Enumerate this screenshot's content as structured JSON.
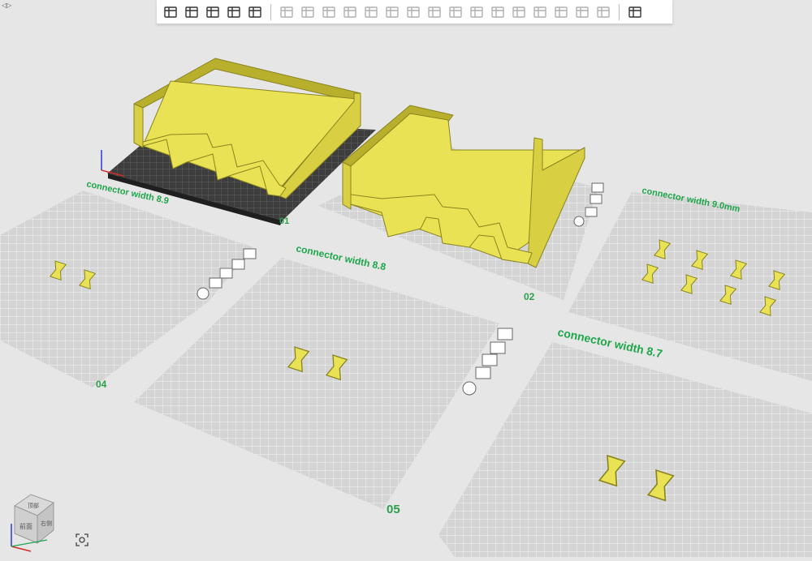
{
  "toolbar": {
    "buttons": [
      {
        "icon": "add-cube-icon",
        "enabled": true
      },
      {
        "icon": "add-plate-icon",
        "enabled": true
      },
      {
        "icon": "auto-orient-icon",
        "enabled": true
      },
      {
        "icon": "arrange-icon",
        "enabled": true
      },
      {
        "icon": "split-layers-icon",
        "enabled": true
      },
      {
        "sep": true
      },
      {
        "icon": "move-icon",
        "enabled": false
      },
      {
        "icon": "rotate-icon",
        "enabled": false
      },
      {
        "icon": "scale-icon",
        "enabled": false
      },
      {
        "icon": "lay-on-face-icon",
        "enabled": false
      },
      {
        "icon": "cut-icon",
        "enabled": false
      },
      {
        "icon": "boolean-icon",
        "enabled": false
      },
      {
        "icon": "support-paint-icon",
        "enabled": false
      },
      {
        "icon": "color-paint-icon",
        "enabled": false
      },
      {
        "icon": "text-icon",
        "enabled": false
      },
      {
        "icon": "measure-icon",
        "enabled": false
      },
      {
        "icon": "assembly-icon",
        "enabled": false
      },
      {
        "icon": "variable-layer-icon",
        "enabled": false
      },
      {
        "icon": "layers-stack-icon",
        "enabled": false
      },
      {
        "icon": "object-list-icon",
        "enabled": false
      },
      {
        "icon": "plate-list-icon",
        "enabled": false
      },
      {
        "icon": "ruler-icon",
        "enabled": false
      },
      {
        "sep": true
      },
      {
        "icon": "view-settings-icon",
        "enabled": true
      }
    ]
  },
  "plates": [
    {
      "id": "plate-01",
      "number": "01",
      "label": ""
    },
    {
      "id": "plate-02",
      "number": "02",
      "label": ""
    },
    {
      "id": "plate-04",
      "number": "04",
      "label": "connector width 8.9"
    },
    {
      "id": "plate-05",
      "number": "05",
      "label": "connector width 8.8"
    },
    {
      "id": "plate-03",
      "number": "",
      "label": "connector width 9.0mm"
    },
    {
      "id": "plate-06",
      "number": "",
      "label": "connector width 8.7"
    }
  ],
  "view_cube": {
    "faces": [
      "顶部",
      "前面",
      "右侧"
    ]
  },
  "colors": {
    "part": "#e9e255",
    "part_shade": "#b8b02c",
    "part_edge": "#8a8420",
    "label_green": "#1ea64a",
    "plate_number": "#2d9f4a",
    "plate": "#d3d3d3",
    "grid": "#ffffff",
    "background": "#e6e6e6",
    "build_plate_dark": "#404040"
  }
}
